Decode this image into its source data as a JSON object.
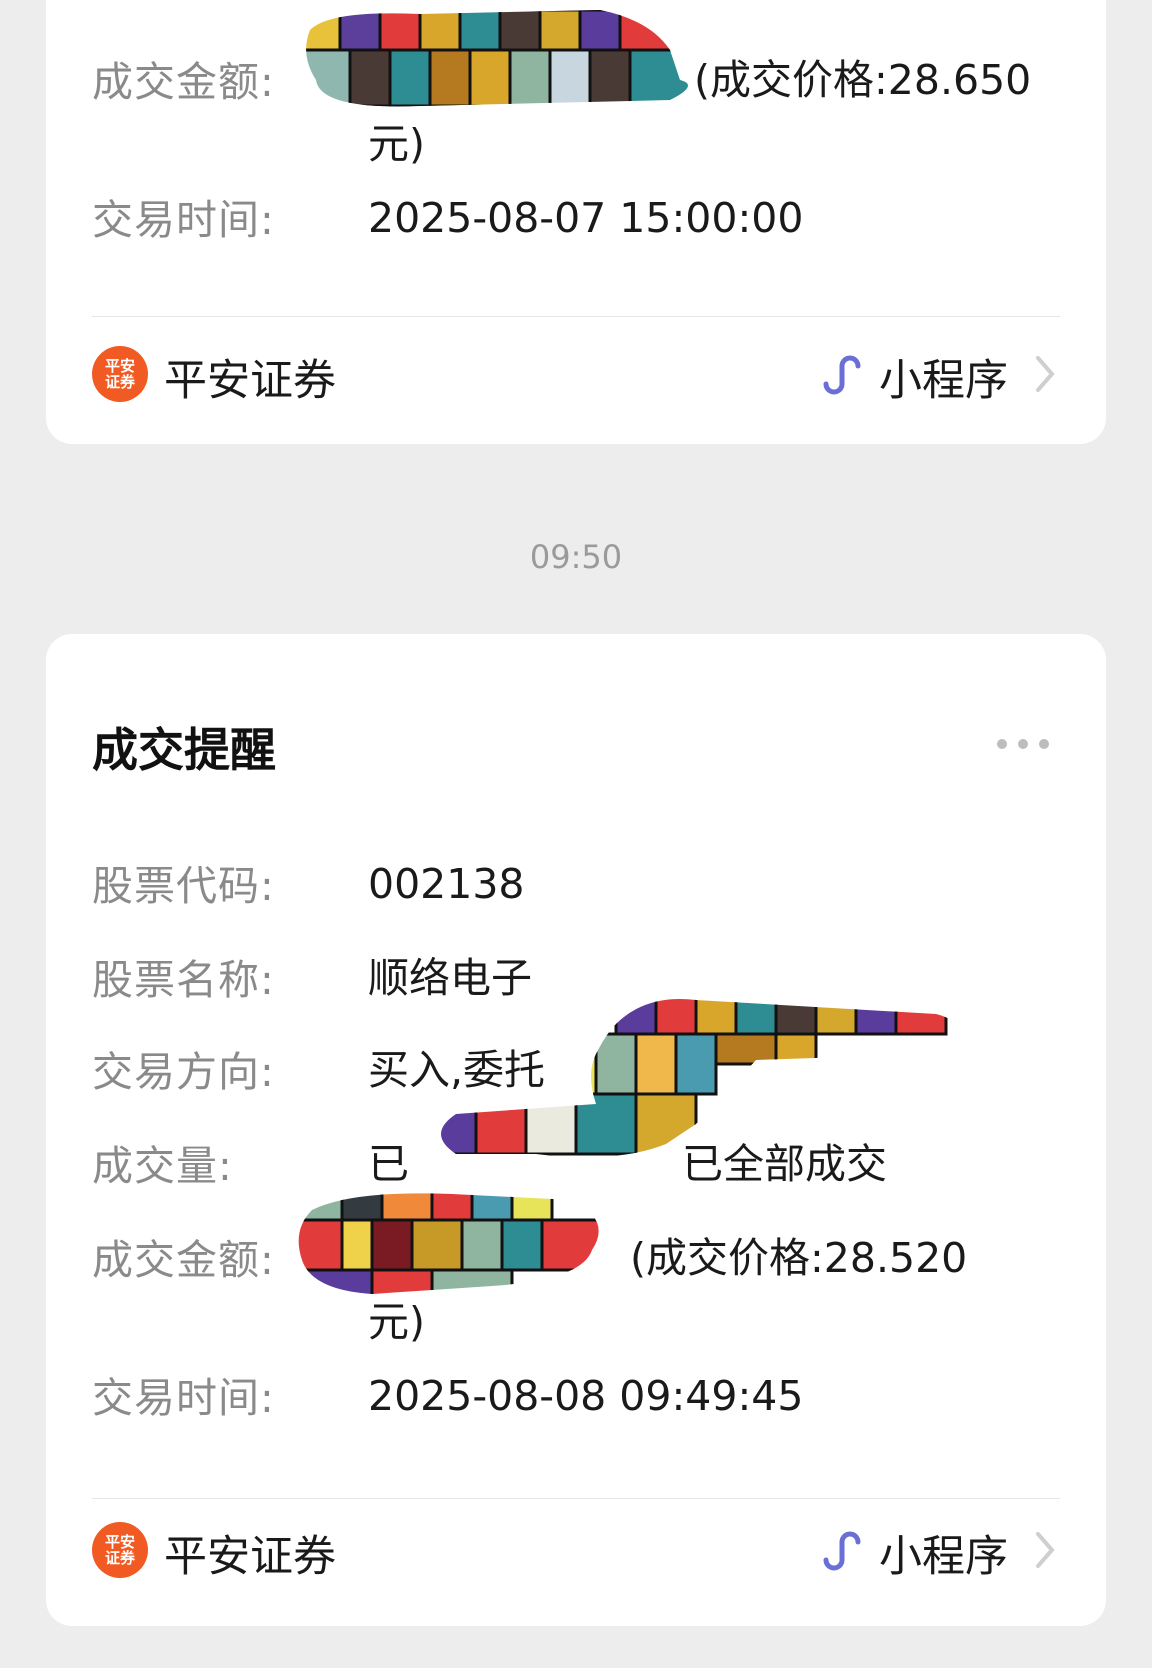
{
  "card1": {
    "rows": [
      {
        "label": "成交金额:",
        "value": "(成交价格:28.650",
        "value_line2": "元)"
      },
      {
        "label": "交易时间:",
        "value": "2025-08-07 15:00:00"
      }
    ],
    "footer": {
      "logo_text": "平安证券",
      "brand": "平安证券",
      "mini_program": "小程序"
    }
  },
  "timestamp": "09:50",
  "card2": {
    "title": "成交提醒",
    "rows": [
      {
        "label": "股票代码:",
        "value": "002138"
      },
      {
        "label": "股票名称:",
        "value": "顺络电子"
      },
      {
        "label": "交易方向:",
        "value": "买入,委托"
      },
      {
        "label": "成交量:",
        "value": "已 已全部成交"
      },
      {
        "label": "成交金额:",
        "value": "(成交价格:28.520",
        "value_line2": "元)"
      },
      {
        "label": "交易时间:",
        "value": "2025-08-08 09:49:45"
      }
    ],
    "footer": {
      "logo_text": "平安证券",
      "brand": "平安证券",
      "mini_program": "小程序"
    }
  },
  "colors": {
    "background": "#ededed",
    "card": "#ffffff",
    "brand_orange": "#f15a22",
    "miniprogram_icon": "#6a6fd6"
  },
  "icons": [
    "more-dots-icon",
    "mini-program-icon",
    "chevron-right-icon",
    "ping-an-logo"
  ]
}
